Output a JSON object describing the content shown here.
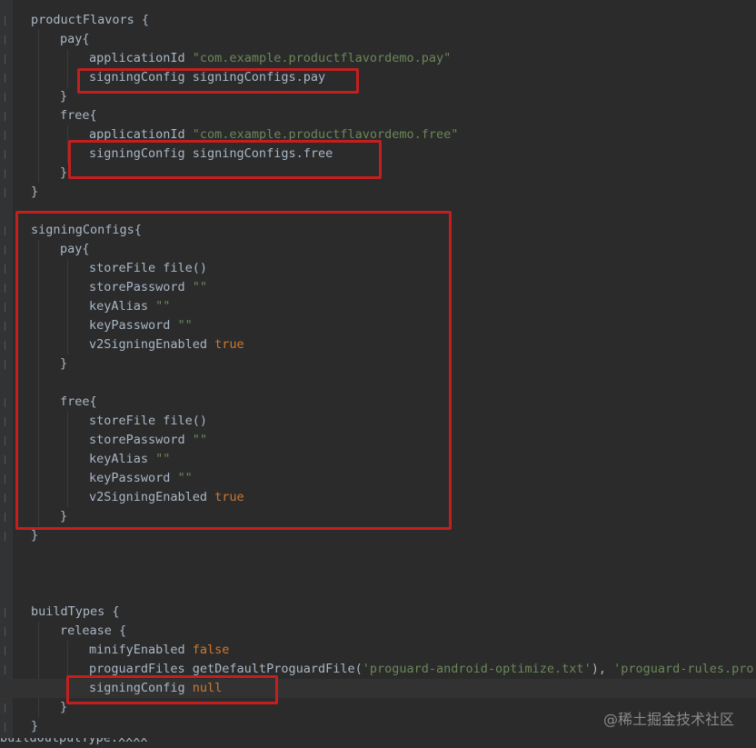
{
  "editor": {
    "lines": [
      [
        {
          "t": "productFlavors {",
          "c": "plain"
        }
      ],
      [
        {
          "t": "pay{",
          "c": "plain"
        }
      ],
      [
        {
          "t": "applicationId ",
          "c": "plain"
        },
        {
          "t": "\"com.example.productflavordemo.pay\"",
          "c": "str"
        }
      ],
      [
        {
          "t": "signingConfig signingConfigs.pay",
          "c": "plain"
        }
      ],
      [
        {
          "t": "}",
          "c": "plain"
        }
      ],
      [
        {
          "t": "free{",
          "c": "plain"
        }
      ],
      [
        {
          "t": "applicationId ",
          "c": "plain"
        },
        {
          "t": "\"com.example.productflavordemo.free\"",
          "c": "str"
        }
      ],
      [
        {
          "t": "signingConfig signingConfigs.free",
          "c": "plain"
        }
      ],
      [
        {
          "t": "}",
          "c": "plain"
        }
      ],
      [
        {
          "t": "}",
          "c": "plain"
        }
      ],
      [
        {
          "t": "signingConfigs{",
          "c": "plain"
        }
      ],
      [
        {
          "t": "pay{",
          "c": "plain"
        }
      ],
      [
        {
          "t": "storeFile file()",
          "c": "plain"
        }
      ],
      [
        {
          "t": "storePassword ",
          "c": "plain"
        },
        {
          "t": "\"\"",
          "c": "str"
        }
      ],
      [
        {
          "t": "keyAlias ",
          "c": "plain"
        },
        {
          "t": "\"\"",
          "c": "str"
        }
      ],
      [
        {
          "t": "keyPassword ",
          "c": "plain"
        },
        {
          "t": "\"\"",
          "c": "str"
        }
      ],
      [
        {
          "t": "v2SigningEnabled ",
          "c": "plain"
        },
        {
          "t": "true",
          "c": "kw"
        }
      ],
      [
        {
          "t": "}",
          "c": "plain"
        }
      ],
      [
        {
          "t": "free{",
          "c": "plain"
        }
      ],
      [
        {
          "t": "storeFile file()",
          "c": "plain"
        }
      ],
      [
        {
          "t": "storePassword ",
          "c": "plain"
        },
        {
          "t": "\"\"",
          "c": "str"
        }
      ],
      [
        {
          "t": "keyAlias ",
          "c": "plain"
        },
        {
          "t": "\"\"",
          "c": "str"
        }
      ],
      [
        {
          "t": "keyPassword ",
          "c": "plain"
        },
        {
          "t": "\"\"",
          "c": "str"
        }
      ],
      [
        {
          "t": "v2SigningEnabled ",
          "c": "plain"
        },
        {
          "t": "true",
          "c": "kw"
        }
      ],
      [
        {
          "t": "}",
          "c": "plain"
        }
      ],
      [
        {
          "t": "}",
          "c": "plain"
        }
      ],
      [
        {
          "t": "buildTypes {",
          "c": "plain"
        }
      ],
      [
        {
          "t": "release {",
          "c": "plain"
        }
      ],
      [
        {
          "t": "minifyEnabled ",
          "c": "plain"
        },
        {
          "t": "false",
          "c": "kw"
        }
      ],
      [
        {
          "t": "proguardFiles getDefaultProguardFile(",
          "c": "plain"
        },
        {
          "t": "'proguard-android-optimize.txt'",
          "c": "str"
        },
        {
          "t": "), ",
          "c": "plain"
        },
        {
          "t": "'proguard-rules.pro'",
          "c": "str"
        }
      ],
      [
        {
          "t": "signingConfig ",
          "c": "plain"
        },
        {
          "t": "null",
          "c": "kw"
        }
      ],
      [
        {
          "t": "}",
          "c": "plain"
        }
      ],
      [
        {
          "t": "}",
          "c": "plain"
        }
      ]
    ],
    "cutoff_line": "buildOutputType.xxxx"
  },
  "watermark": "@稀土掘金技术社区",
  "colors": {
    "background": "#2b2b2b",
    "text": "#a9b7c6",
    "string": "#6a8759",
    "keyword": "#cc7832",
    "highlight_box": "#c41f1f"
  }
}
